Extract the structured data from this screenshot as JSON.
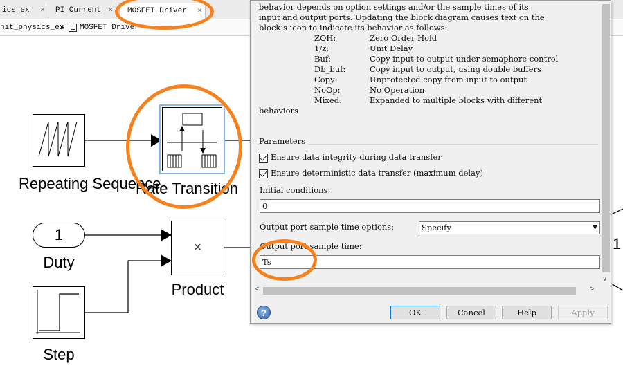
{
  "tabs": [
    {
      "label": "ics_ex",
      "active": false
    },
    {
      "label": "PI Current",
      "active": false
    },
    {
      "label": "MOSFET Driver",
      "active": true
    }
  ],
  "tab_close_glyph": "✕",
  "breadcrumb": {
    "root": "nit_physics_ex",
    "current": "MOSFET Driver"
  },
  "canvas": {
    "blocks": {
      "repeating_sequence": "Repeating Sequence",
      "rate_transition": "Rate Transition",
      "duty": "Duty",
      "duty_value": "1",
      "product": "Product",
      "product_symbol": "×",
      "step": "Step",
      "partial_right_value": "1"
    }
  },
  "dialog": {
    "description_lines": [
      "behavior depends on option settings and/or the sample times of its",
      "input and output ports. Updating the block diagram causes text on the",
      "block’s icon to indicate its behavior as follows:"
    ],
    "behaviors": [
      {
        "key": "ZOH:",
        "value": "Zero Order Hold"
      },
      {
        "key": "1/z:",
        "value": "Unit Delay"
      },
      {
        "key": "Buf:",
        "value": "Copy input to output under semaphore control"
      },
      {
        "key": "Db_buf:",
        "value": "Copy input to output, using double buffers"
      },
      {
        "key": "Copy:",
        "value": "Unprotected copy from input to output"
      },
      {
        "key": "NoOp:",
        "value": "No Operation"
      },
      {
        "key": "Mixed:",
        "value": "Expanded to multiple blocks with different"
      }
    ],
    "behaviors_tail": "behaviors",
    "parameters_title": "Parameters",
    "ensure_integrity": {
      "label": "Ensure data integrity during data transfer",
      "checked": true
    },
    "ensure_deterministic": {
      "label": "Ensure deterministic data transfer (maximum delay)",
      "checked": true
    },
    "initial_conditions_label": "Initial conditions:",
    "initial_conditions_value": "0",
    "sample_time_options_label": "Output port sample time options:",
    "sample_time_options_value": "Specify",
    "sample_time_label": "Output port sample time:",
    "sample_time_value": "Ts",
    "buttons": {
      "ok": "OK",
      "cancel": "Cancel",
      "help": "Help",
      "apply": "Apply"
    },
    "help_icon_glyph": "?"
  },
  "icons": {
    "breadcrumb_arrow": "▶",
    "dropdown_arrow": "▼",
    "scroll_left": "<",
    "scroll_right": ">",
    "scroll_down": "∨"
  },
  "highlight_color": "#f5821f"
}
